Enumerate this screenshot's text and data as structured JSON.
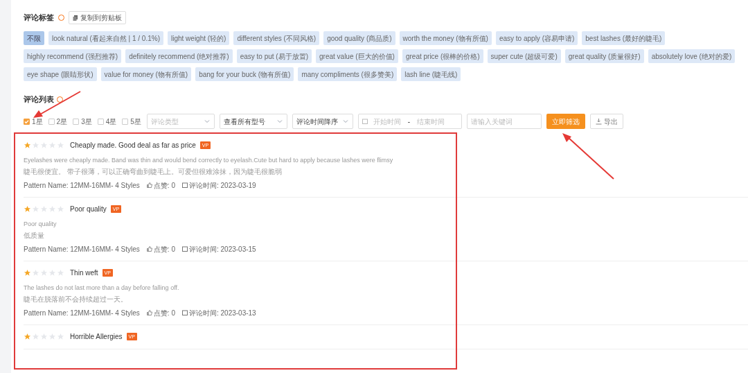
{
  "tags_section": {
    "title": "评论标签",
    "copy_button": "复制到剪贴板",
    "tags": [
      {
        "label": "不限",
        "selected": true
      },
      {
        "label": "look natural (看起来自然 | 1 / 0.1%)",
        "selected": false
      },
      {
        "label": "light weight (轻的)",
        "selected": false
      },
      {
        "label": "different styles (不同风格)",
        "selected": false
      },
      {
        "label": "good quality (商品质)",
        "selected": false
      },
      {
        "label": "worth the money (物有所值)",
        "selected": false
      },
      {
        "label": "easy to apply (容易申请)",
        "selected": false
      },
      {
        "label": "best lashes (最好的睫毛)",
        "selected": false
      },
      {
        "label": "highly recommend (强烈推荐)",
        "selected": false
      },
      {
        "label": "definitely recommend (绝对推荐)",
        "selected": false
      },
      {
        "label": "easy to put (易于放置)",
        "selected": false
      },
      {
        "label": "great value (巨大的价值)",
        "selected": false
      },
      {
        "label": "great price (很棒的价格)",
        "selected": false
      },
      {
        "label": "super cute (超级可爱)",
        "selected": false
      },
      {
        "label": "great quality (质量很好)",
        "selected": false
      },
      {
        "label": "absolutely love (绝对的爱)",
        "selected": false
      },
      {
        "label": "eye shape (眼睛形状)",
        "selected": false
      },
      {
        "label": "value for money (物有所值)",
        "selected": false
      },
      {
        "label": "bang for your buck (物有所值)",
        "selected": false
      },
      {
        "label": "many compliments (很多赞美)",
        "selected": false
      },
      {
        "label": "lash line (睫毛线)",
        "selected": false
      }
    ]
  },
  "list_section": {
    "title": "评论列表",
    "star_filters": [
      {
        "label": "1星",
        "checked": true
      },
      {
        "label": "2星",
        "checked": false
      },
      {
        "label": "3星",
        "checked": false
      },
      {
        "label": "4星",
        "checked": false
      },
      {
        "label": "5星",
        "checked": false
      }
    ],
    "dropdowns": [
      {
        "placeholder": "评论类型"
      },
      {
        "value": "查看所有型号"
      },
      {
        "value": "评论时间降序"
      }
    ],
    "date_range": {
      "start_placeholder": "开始时间",
      "separator": "-",
      "end_placeholder": "结束时间"
    },
    "keyword": {
      "placeholder": "请输入关键词"
    },
    "filter_button": "立即筛选",
    "export_button": "导出",
    "reviews": [
      {
        "stars": 1,
        "title": "Cheaply made. Good deal as far as price",
        "badge": "VP",
        "body": "Eyelashes were cheaply made. Band was thin and would bend correctly to eyelash.Cute but hard to apply because lashes were flimsy",
        "translation": "睫毛很便宜。 带子很薄，可以正确弯曲到睫毛上。可爱但很难涂抹，因为睫毛很脆弱",
        "pattern": "Pattern Name: 12MM-16MM- 4 Styles",
        "likes": "点赞: 0",
        "date": "评论时间: 2023-03-19"
      },
      {
        "stars": 1,
        "title": "Poor quality",
        "badge": "VP",
        "body": "Poor quality",
        "translation": "低质量",
        "pattern": "Pattern Name: 12MM-16MM- 4 Styles",
        "likes": "点赞: 0",
        "date": "评论时间: 2023-03-15"
      },
      {
        "stars": 1,
        "title": "Thin weft",
        "badge": "VP",
        "body": "The lashes do not last more than a day before falling off.",
        "translation": "睫毛在脱落前不会持续超过一天。",
        "pattern": "Pattern Name: 12MM-16MM- 4 Styles",
        "likes": "点赞: 0",
        "date": "评论时间: 2023-03-13"
      },
      {
        "stars": 1,
        "title": "Horrible Allergies",
        "badge": "VP"
      }
    ]
  }
}
